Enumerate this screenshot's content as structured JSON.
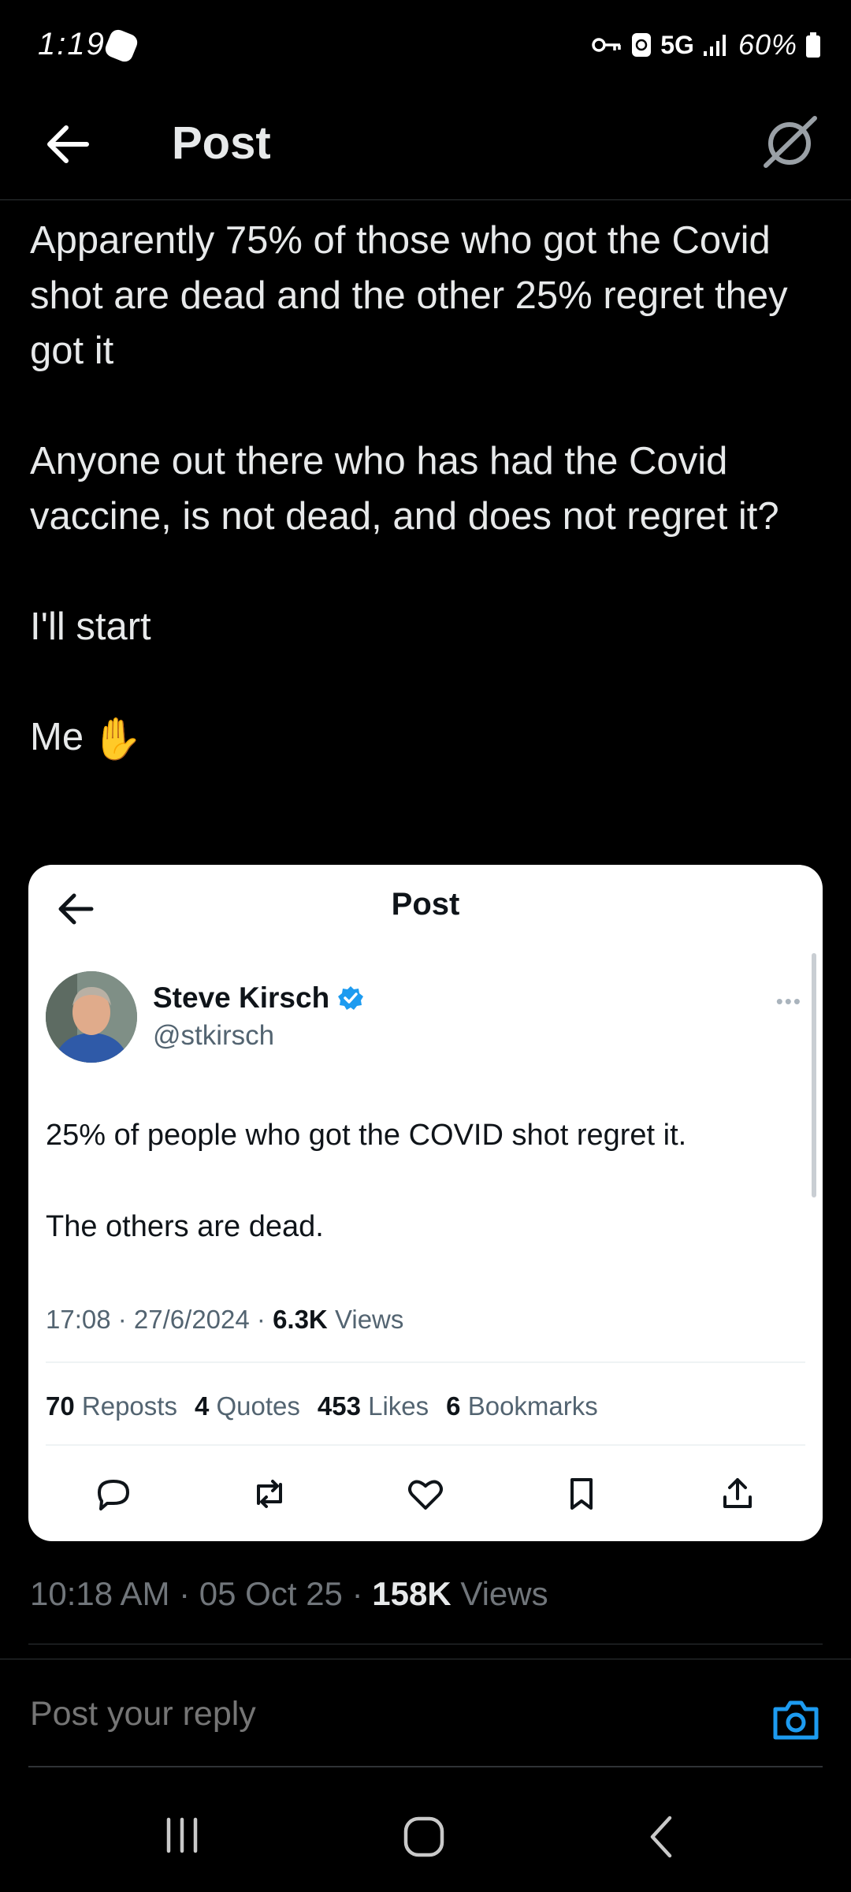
{
  "status_bar": {
    "time": "1:19",
    "network": "5G",
    "battery": "60%"
  },
  "header": {
    "title": "Post"
  },
  "post": {
    "paragraphs": [
      "Apparently 75% of those who got the Covid shot are dead and the other 25% regret they got it",
      "Anyone out there who has had the Covid vaccine, is not dead, and does not regret it?",
      "I'll start",
      "Me"
    ],
    "emoji": "✋",
    "time": "10:18 AM",
    "date": "05 Oct 25",
    "views_count": "158K",
    "views_label": "Views"
  },
  "embedded": {
    "title": "Post",
    "author_name": "Steve Kirsch",
    "author_handle": "@stkirsch",
    "text_1": "25% of people who got the COVID shot regret it.",
    "text_2": "The others are dead.",
    "time": "17:08",
    "date": "27/6/2024",
    "views_count": "6.3K",
    "views_label": "Views",
    "reposts_count": "70",
    "reposts_label": "Reposts",
    "quotes_count": "4",
    "quotes_label": "Quotes",
    "likes_count": "453",
    "likes_label": "Likes",
    "bookmarks_count": "6",
    "bookmarks_label": "Bookmarks"
  },
  "reply": {
    "placeholder": "Post your reply"
  },
  "icons": {
    "back": "arrow-left-icon",
    "grok": "grok-icon",
    "camera": "camera-icon",
    "verified": "verified-badge-icon",
    "reply": "reply-icon",
    "repost": "repost-icon",
    "like": "heart-icon",
    "bookmark": "bookmark-icon",
    "share": "share-icon"
  },
  "colors": {
    "background": "#000000",
    "text_primary": "#e7e9ea",
    "text_secondary": "#71767b",
    "accent": "#1d9bf0",
    "card_background": "#ffffff"
  }
}
